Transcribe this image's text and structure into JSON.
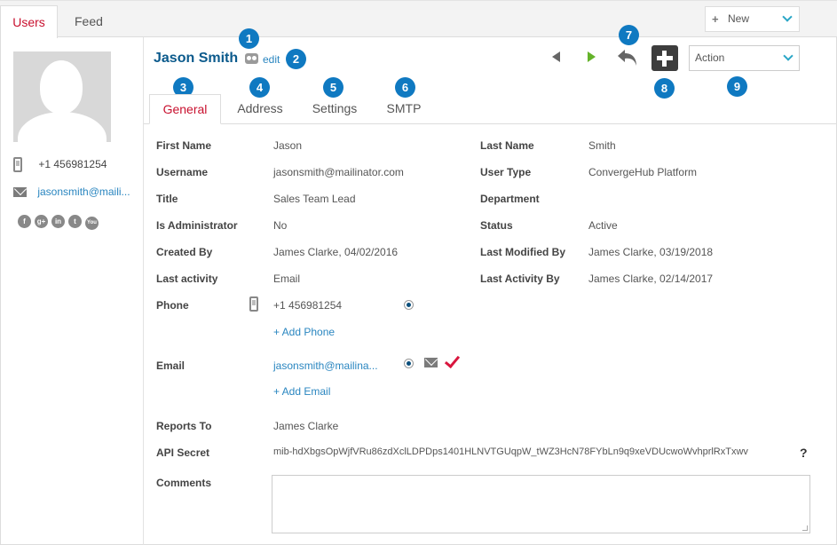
{
  "top_tabs": [
    {
      "label": "Users"
    },
    {
      "label": "Feed"
    }
  ],
  "new_button": {
    "label": "New",
    "icon": "plus-icon"
  },
  "sidebar": {
    "phone": "+1 456981254",
    "email": "jasonsmith@maili...",
    "social": [
      "f",
      "g+",
      "in",
      "t",
      "You"
    ]
  },
  "header": {
    "name": "Jason Smith",
    "edit_label": "edit",
    "action_label": "Action"
  },
  "badges": [
    "1",
    "2",
    "3",
    "4",
    "5",
    "6",
    "7",
    "8",
    "9"
  ],
  "content_tabs": [
    {
      "label": "General"
    },
    {
      "label": "Address"
    },
    {
      "label": "Settings"
    },
    {
      "label": "SMTP"
    }
  ],
  "fields": {
    "first_name": {
      "label": "First Name",
      "value": "Jason"
    },
    "last_name": {
      "label": "Last Name",
      "value": "Smith"
    },
    "username": {
      "label": "Username",
      "value": "jasonsmith@mailinator.com"
    },
    "user_type": {
      "label": "User Type",
      "value": "ConvergeHub Platform"
    },
    "title": {
      "label": "Title",
      "value": "Sales Team Lead"
    },
    "department": {
      "label": "Department",
      "value": ""
    },
    "is_admin": {
      "label": "Is Administrator",
      "value": "No"
    },
    "status": {
      "label": "Status",
      "value": "Active"
    },
    "created_by": {
      "label": "Created By",
      "value": "James Clarke, 04/02/2016"
    },
    "last_modified_by": {
      "label": "Last Modified By",
      "value": "James Clarke, 03/19/2018"
    },
    "last_activity": {
      "label": "Last activity",
      "value": "Email"
    },
    "last_activity_by": {
      "label": "Last Activity By",
      "value": "James Clarke, 02/14/2017"
    },
    "phone": {
      "label": "Phone",
      "value": "+1 456981254",
      "add_label": "+ Add Phone"
    },
    "email": {
      "label": "Email",
      "value": "jasonsmith@mailina...",
      "add_label": "+ Add Email"
    },
    "reports_to": {
      "label": "Reports To",
      "value": "James Clarke"
    },
    "api_secret": {
      "label": "API Secret",
      "value": "mib-hdXbgsOpWjfVRu86zdXclLDPDps1401HLNVTGUqpW_tWZ3HcN78FYbLn9q9xeVDUcwoWvhprlRxTxwv"
    },
    "comments": {
      "label": "Comments",
      "value": ""
    }
  },
  "help_mark": "?",
  "colors": {
    "accent_red": "#c8102e",
    "link_blue": "#2a86c0",
    "badge_blue": "#0f79c1",
    "next_green": "#64b32a"
  }
}
